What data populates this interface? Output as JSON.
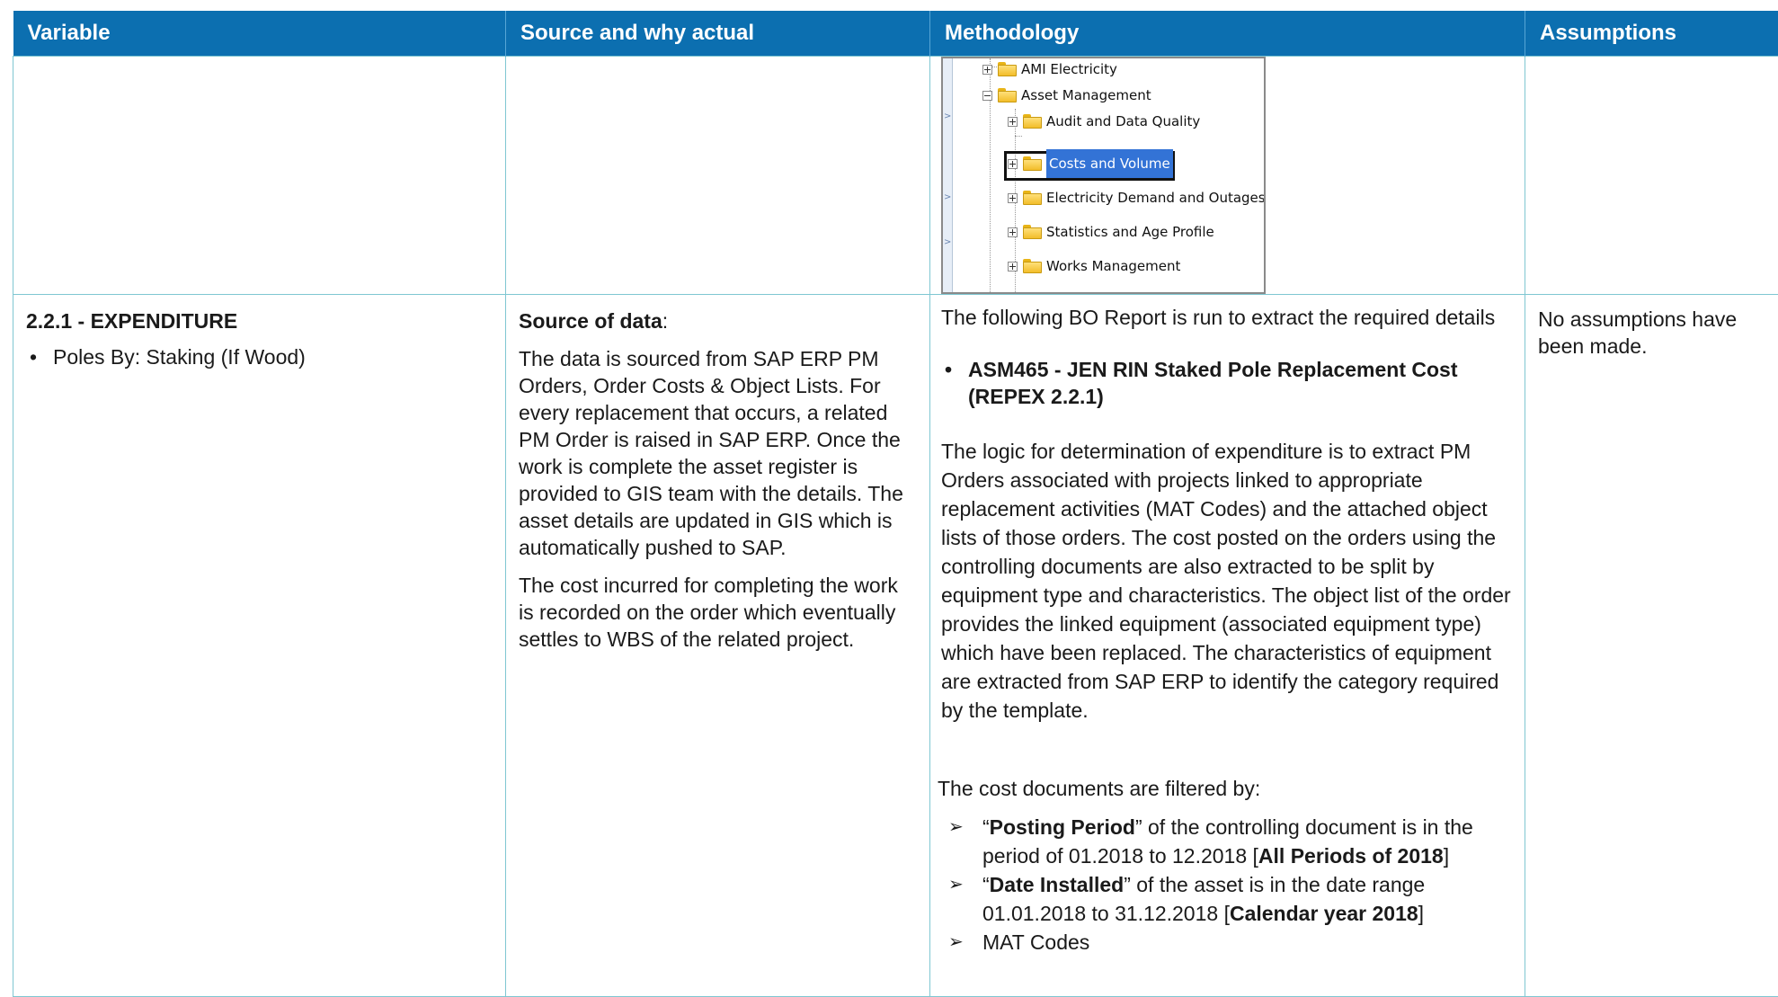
{
  "headers": {
    "variable": "Variable",
    "source": "Source and why actual",
    "methodology": "Methodology",
    "assumptions": "Assumptions"
  },
  "tree": {
    "items": [
      {
        "label": "AMI Electricity",
        "state": "collapsed",
        "level": 1
      },
      {
        "label": "Asset Management",
        "state": "expanded",
        "level": 1
      },
      {
        "label": "Audit and Data Quality",
        "state": "collapsed",
        "level": 2
      },
      {
        "label": "Costs and Volume",
        "state": "collapsed",
        "level": 2,
        "selected": true
      },
      {
        "label": "Electricity Demand and Outages",
        "state": "collapsed",
        "level": 2
      },
      {
        "label": "Statistics and Age Profile",
        "state": "collapsed",
        "level": 2
      },
      {
        "label": "Works Management",
        "state": "collapsed",
        "level": 2
      }
    ]
  },
  "row": {
    "variable_title": "2.2.1 - EXPENDITURE",
    "variable_bullet": "Poles By: Staking (If Wood)",
    "source_label": "Source of data",
    "source_colon": ":",
    "source_p1": "The data is sourced from SAP ERP PM Orders, Order Costs & Object Lists. For every replacement that occurs, a related PM Order is raised in SAP ERP. Once the work is complete the asset register is provided to GIS team with the details. The asset details are updated in GIS which is automatically pushed to SAP.",
    "source_p2": "The cost incurred for completing the work is recorded on the order which eventually settles to WBS of the related project.",
    "meth_intro": "The following BO Report is run to extract the required details",
    "meth_report": "ASM465 - JEN RIN Staked Pole Replacement Cost (REPEX 2.2.1)",
    "meth_logic": "The logic for determination of expenditure is to extract PM Orders associated with projects linked to appropriate replacement activities (MAT Codes) and the attached object lists of those orders. The cost posted on the orders using the controlling documents are also extracted to be split by equipment type and characteristics. The object list of the order provides the linked equipment (associated equipment type) which have been replaced. The characteristics of equipment are extracted from SAP ERP to identify the category required by the template.",
    "meth_filter_intro": "The cost documents are filtered by:",
    "filters": {
      "f1_open": "“",
      "f1_bold": "Posting Period",
      "f1_mid": "” of the controlling document is in the period of 01.2018 to 12.2018 [",
      "f1_bold2": "All Periods of 2018",
      "f1_close": "]",
      "f2_open": "“",
      "f2_bold": "Date Installed",
      "f2_mid": "” of the asset is in the date range 01.01.2018 to 31.12.2018 [",
      "f2_bold2": "Calendar year 2018",
      "f2_close": "]",
      "f3": "MAT Codes"
    },
    "assumptions": "No assumptions have been made."
  }
}
